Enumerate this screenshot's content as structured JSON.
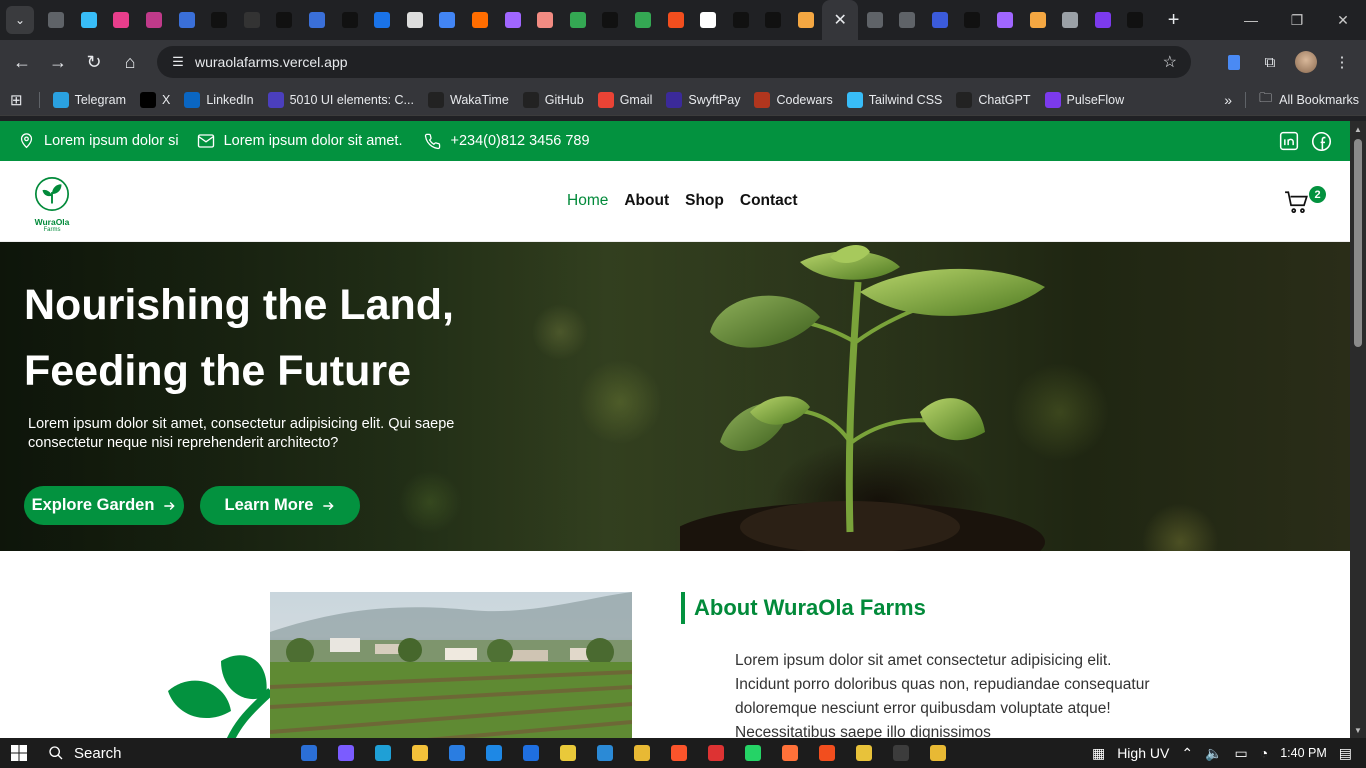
{
  "browser": {
    "tabs": [
      {
        "icon": "page-icon",
        "color": "#5f6368"
      },
      {
        "icon": "tailwind-icon",
        "color": "#38bdf8"
      },
      {
        "icon": "react-icon",
        "color": "#e83e8c"
      },
      {
        "icon": "app-icon",
        "color": "#c03a8a"
      },
      {
        "icon": "azure-icon",
        "color": "#3a6fd8"
      },
      {
        "icon": "a-icon",
        "color": "#111111"
      },
      {
        "icon": "page-icon",
        "color": "#333333"
      },
      {
        "icon": "triangle-icon",
        "color": "#111111"
      },
      {
        "icon": "azure-icon",
        "color": "#3a6fd8"
      },
      {
        "icon": "terminal-icon",
        "color": "#111111"
      },
      {
        "icon": "circle-icon",
        "color": "#1a73e8"
      },
      {
        "icon": "loop-icon",
        "color": "#dddddd"
      },
      {
        "icon": "doc-icon",
        "color": "#4285f4"
      },
      {
        "icon": "fire-icon",
        "color": "#ff6d00"
      },
      {
        "icon": "vite-icon",
        "color": "#a066ff"
      },
      {
        "icon": "slides-icon",
        "color": "#f28b82"
      },
      {
        "icon": "meet-icon",
        "color": "#34a853"
      },
      {
        "icon": "triangle-icon",
        "color": "#111111"
      },
      {
        "icon": "person-icon",
        "color": "#34a853"
      },
      {
        "icon": "figma-icon",
        "color": "#f24e1e"
      },
      {
        "icon": "github-icon",
        "color": "#ffffff"
      },
      {
        "icon": "triangle-icon",
        "color": "#111111"
      },
      {
        "icon": "triangle-icon",
        "color": "#111111"
      },
      {
        "icon": "z-icon",
        "color": "#f4a742"
      }
    ],
    "tabs_after": [
      {
        "icon": "page-icon",
        "color": "#5f6368"
      },
      {
        "icon": "page-icon",
        "color": "#5f6368"
      },
      {
        "icon": "form-icon",
        "color": "#3b5bdb"
      },
      {
        "icon": "st-icon",
        "color": "#111111"
      },
      {
        "icon": "vite-icon",
        "color": "#a066ff"
      },
      {
        "icon": "pen-icon",
        "color": "#f4a742"
      },
      {
        "icon": "chrome-icon",
        "color": "#9aa0a6"
      },
      {
        "icon": "purple-icon",
        "color": "#7c3aed"
      },
      {
        "icon": "triangle-icon",
        "color": "#111111"
      }
    ],
    "url": "wuraolafarms.vercel.app",
    "bookmarks": [
      {
        "label": "Telegram",
        "icon": "telegram-icon",
        "color": "#2aa1e0"
      },
      {
        "label": "X",
        "icon": "x-icon",
        "color": "#000000"
      },
      {
        "label": "LinkedIn",
        "icon": "linkedin-icon",
        "color": "#0a66c2"
      },
      {
        "label": "5010 UI elements: C...",
        "icon": "uiverse-icon",
        "color": "#4b3fbd"
      },
      {
        "label": "WakaTime",
        "icon": "wakatime-icon",
        "color": "#222222"
      },
      {
        "label": "GitHub",
        "icon": "github-icon",
        "color": "#222222"
      },
      {
        "label": "Gmail",
        "icon": "gmail-icon",
        "color": "#ea4335"
      },
      {
        "label": "SwyftPay",
        "icon": "swyftpay-icon",
        "color": "#3b2a9a"
      },
      {
        "label": "Codewars",
        "icon": "codewars-icon",
        "color": "#b1361e"
      },
      {
        "label": "Tailwind CSS",
        "icon": "tailwind-icon",
        "color": "#38bdf8"
      },
      {
        "label": "ChatGPT",
        "icon": "chatgpt-icon",
        "color": "#222222"
      },
      {
        "label": "PulseFlow",
        "icon": "pulseflow-icon",
        "color": "#7c3aed"
      }
    ],
    "all_bookmarks": "All Bookmarks"
  },
  "site": {
    "brand_color": "#03923f",
    "topbar": {
      "location": "Lorem ipsum dolor si",
      "email": "Lorem ipsum dolor sit amet.",
      "phone": "+234(0)812 3456 789"
    },
    "logo": {
      "word": "WuraOla",
      "sub": "Farms"
    },
    "nav": [
      {
        "label": "Home",
        "active": true
      },
      {
        "label": "About",
        "active": false
      },
      {
        "label": "Shop",
        "active": false
      },
      {
        "label": "Contact",
        "active": false
      }
    ],
    "cart_count": "2",
    "hero": {
      "title_line1": "Nourishing the Land,",
      "title_line2": "Feeding the Future",
      "text": "Lorem ipsum dolor sit amet, consectetur adipisicing elit. Qui saepe consectetur neque nisi reprehenderit architecto?",
      "btn_explore": "Explore Garden",
      "btn_learn": "Learn More"
    },
    "about": {
      "heading": "About WuraOla Farms",
      "body": "Lorem ipsum dolor sit amet consectetur adipisicing elit. Incidunt porro doloribus quas non, repudiandae consequatur doloremque nesciunt error quibusdam voluptate atque! Necessitatibus saepe illo dignissimos"
    }
  },
  "taskbar": {
    "search": "Search",
    "weather": "High UV",
    "time": "1:40 PM"
  }
}
